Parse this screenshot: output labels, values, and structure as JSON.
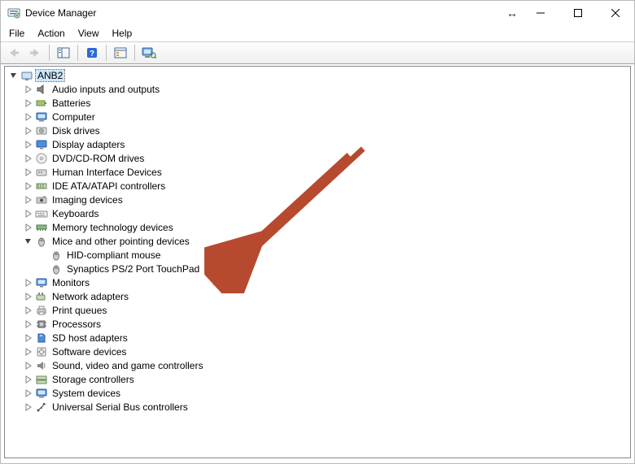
{
  "window": {
    "title": "Device Manager"
  },
  "menu": {
    "file": "File",
    "action": "Action",
    "view": "View",
    "help": "Help"
  },
  "tree": {
    "root": "ANB2",
    "categories": [
      {
        "label": "Audio inputs and outputs",
        "icon": "audio"
      },
      {
        "label": "Batteries",
        "icon": "battery"
      },
      {
        "label": "Computer",
        "icon": "computer"
      },
      {
        "label": "Disk drives",
        "icon": "disk"
      },
      {
        "label": "Display adapters",
        "icon": "display"
      },
      {
        "label": "DVD/CD-ROM drives",
        "icon": "dvd"
      },
      {
        "label": "Human Interface Devices",
        "icon": "hid"
      },
      {
        "label": "IDE ATA/ATAPI controllers",
        "icon": "ide"
      },
      {
        "label": "Imaging devices",
        "icon": "imaging"
      },
      {
        "label": "Keyboards",
        "icon": "keyboard"
      },
      {
        "label": "Memory technology devices",
        "icon": "memory"
      },
      {
        "label": "Mice and other pointing devices",
        "icon": "mouse",
        "expanded": true,
        "children": [
          {
            "label": "HID-compliant mouse",
            "icon": "mouse"
          },
          {
            "label": "Synaptics PS/2 Port TouchPad",
            "icon": "mouse"
          }
        ]
      },
      {
        "label": "Monitors",
        "icon": "monitor"
      },
      {
        "label": "Network adapters",
        "icon": "network"
      },
      {
        "label": "Print queues",
        "icon": "printer"
      },
      {
        "label": "Processors",
        "icon": "cpu"
      },
      {
        "label": "SD host adapters",
        "icon": "sd"
      },
      {
        "label": "Software devices",
        "icon": "software"
      },
      {
        "label": "Sound, video and game controllers",
        "icon": "sound"
      },
      {
        "label": "Storage controllers",
        "icon": "storage"
      },
      {
        "label": "System devices",
        "icon": "system"
      },
      {
        "label": "Universal Serial Bus controllers",
        "icon": "usb"
      }
    ]
  },
  "annotation": {
    "arrow_color": "#b74a2e"
  }
}
